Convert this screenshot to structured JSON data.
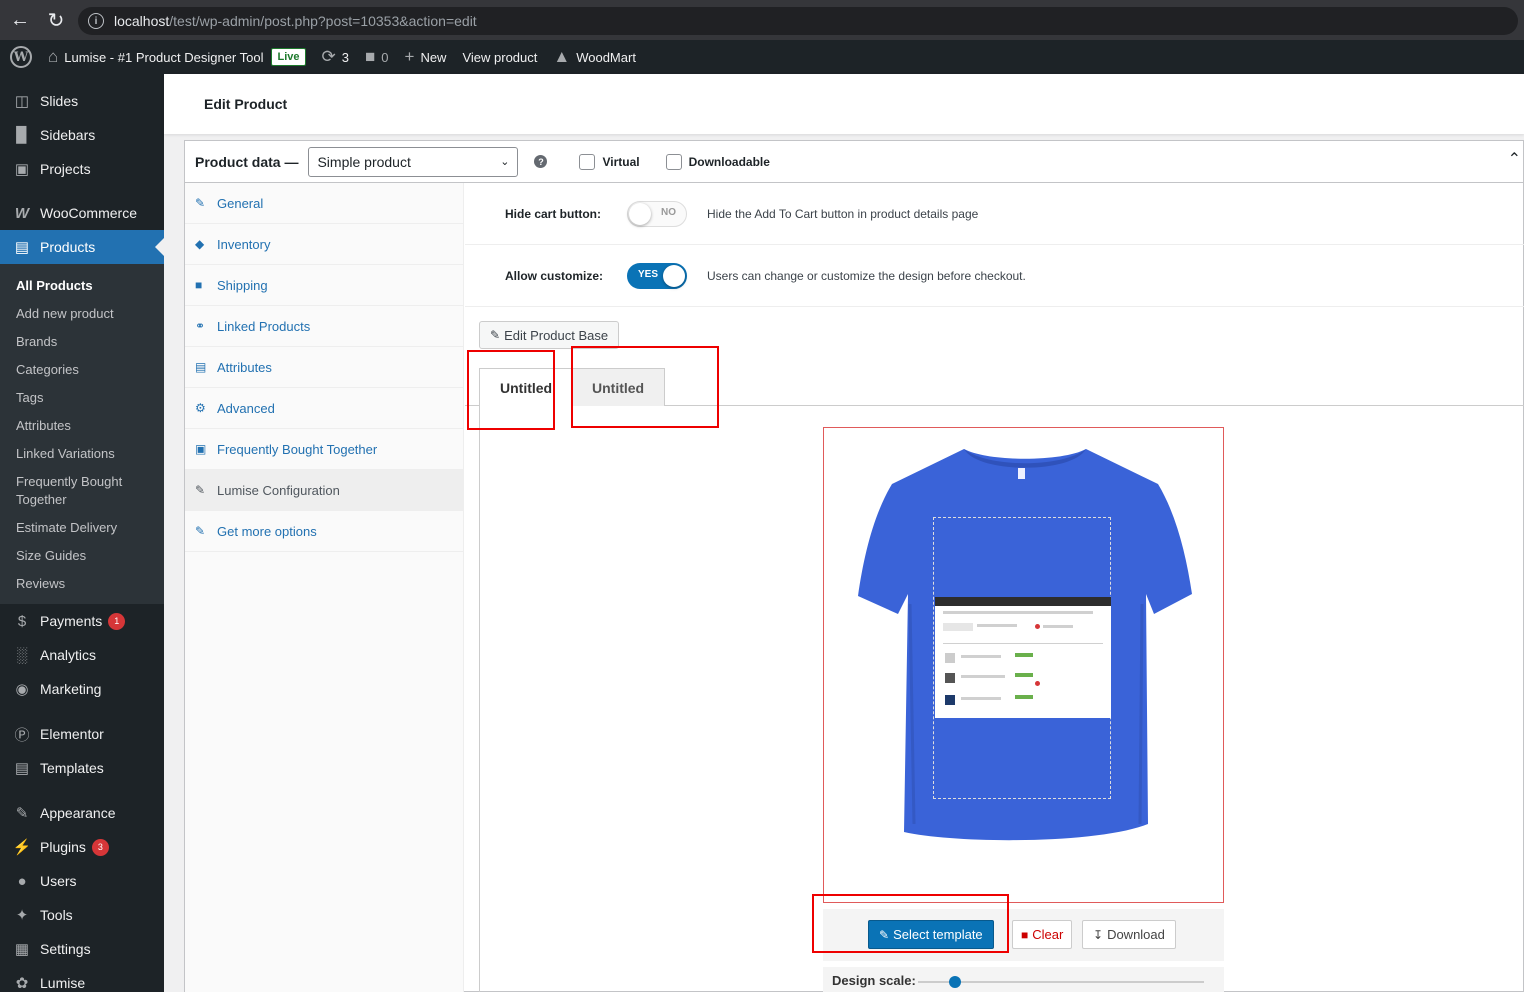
{
  "browser": {
    "url_host": "localhost",
    "url_path": "/test/wp-admin/post.php?post=10353&action=edit"
  },
  "adminbar": {
    "site_name": "Lumise - #1 Product Designer Tool",
    "live_label": "Live",
    "updates_count": "3",
    "comments_count": "0",
    "new_label": "New",
    "view_product_label": "View product",
    "theme_label": "WoodMart"
  },
  "sidebar": {
    "items_top": [
      {
        "label": "Slides",
        "icon": "slides-icon"
      },
      {
        "label": "Sidebars",
        "icon": "sidebars-icon"
      },
      {
        "label": "Projects",
        "icon": "projects-icon"
      }
    ],
    "woocommerce": "WooCommerce",
    "products": "Products",
    "submenu": [
      "All Products",
      "Add new product",
      "Brands",
      "Categories",
      "Tags",
      "Attributes",
      "Linked Variations",
      "Frequently Bought Together",
      "Estimate Delivery",
      "Size Guides",
      "Reviews"
    ],
    "payments": "Payments",
    "payments_badge": "1",
    "analytics": "Analytics",
    "marketing": "Marketing",
    "elementor": "Elementor",
    "templates": "Templates",
    "appearance": "Appearance",
    "plugins": "Plugins",
    "plugins_badge": "3",
    "users": "Users",
    "tools": "Tools",
    "settings": "Settings",
    "lumise": "Lumise"
  },
  "header": {
    "title": "Edit Product"
  },
  "product_data": {
    "label": "Product data —",
    "type_value": "Simple product",
    "virtual_label": "Virtual",
    "downloadable_label": "Downloadable"
  },
  "tabs": [
    {
      "label": "General",
      "icon": "wrench-icon"
    },
    {
      "label": "Inventory",
      "icon": "tag-icon"
    },
    {
      "label": "Shipping",
      "icon": "truck-icon"
    },
    {
      "label": "Linked Products",
      "icon": "link-icon"
    },
    {
      "label": "Attributes",
      "icon": "list-icon"
    },
    {
      "label": "Advanced",
      "icon": "gear-icon"
    },
    {
      "label": "Frequently Bought Together",
      "icon": "bag-icon"
    },
    {
      "label": "Lumise Configuration",
      "icon": "brush-icon"
    },
    {
      "label": "Get more options",
      "icon": "plug-icon"
    }
  ],
  "options": {
    "hide_cart_label": "Hide cart button:",
    "hide_cart_toggle": "NO",
    "hide_cart_desc": "Hide the Add To Cart button in product details page",
    "allow_customize_label": "Allow customize:",
    "allow_customize_toggle": "YES",
    "allow_customize_desc": "Users can change or customize the design before checkout."
  },
  "edit_product_base_label": "Edit Product Base",
  "stage_tabs": [
    "Untitled",
    "Untitled"
  ],
  "design_tools": {
    "select_template": "Select template",
    "clear": "Clear",
    "download": "Download",
    "design_scale_label": "Design scale:",
    "design_scale_value": 0.13
  },
  "colors": {
    "admin_dark": "#1d2327",
    "wp_blue": "#2271b1",
    "tshirt_blue": "#3a63d8",
    "annotation_red": "#ee0000"
  }
}
